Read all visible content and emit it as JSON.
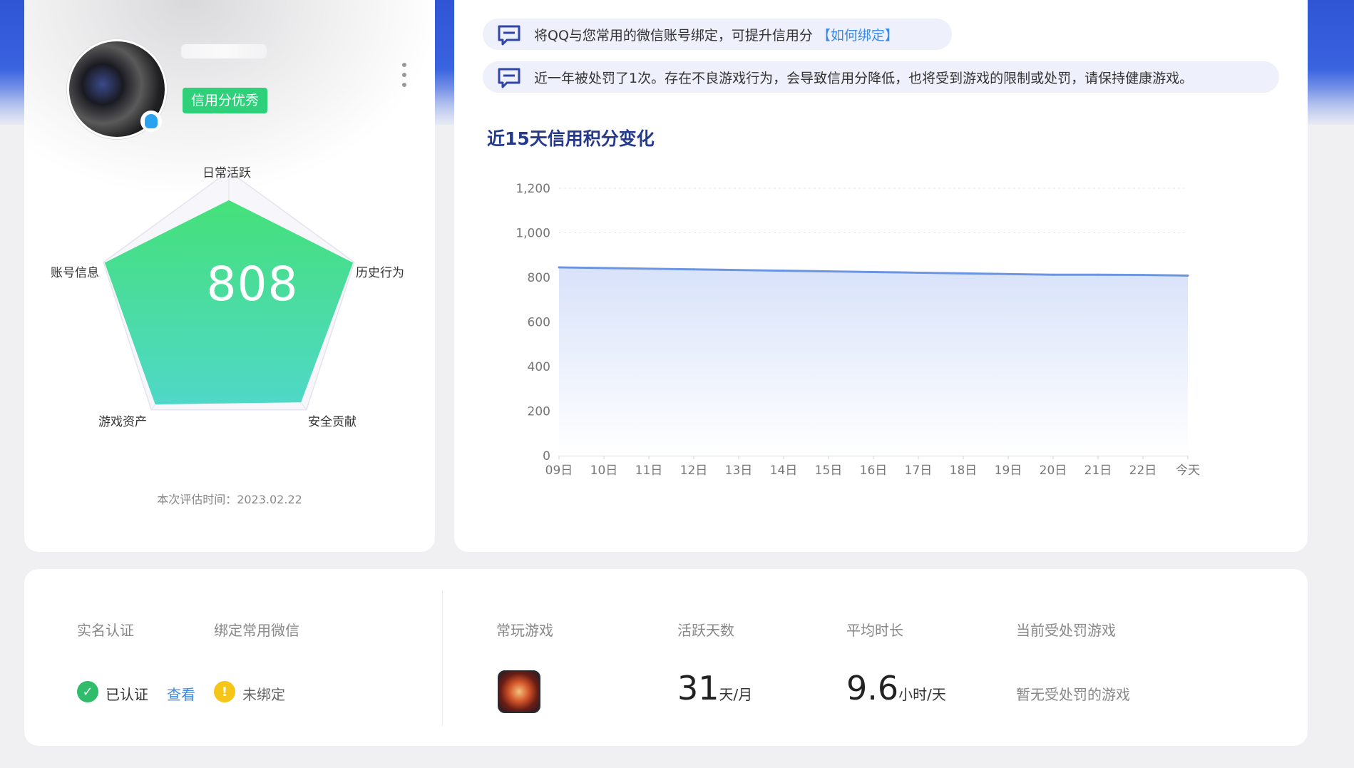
{
  "profile": {
    "credit_badge": "信用分优秀",
    "score": "808",
    "eval_time": "本次评估时间：2023.02.22",
    "radar": {
      "axes": [
        "日常活跃",
        "历史行为",
        "安全贡献",
        "游戏资产",
        "账号信息"
      ],
      "values": [
        0.78,
        0.99,
        0.93,
        0.95,
        0.99
      ]
    }
  },
  "notices": [
    {
      "text": "将QQ与您常用的微信账号绑定，可提升信用分",
      "link": "【如何绑定】"
    },
    {
      "text": "近一年被处罚了1次。存在不良游戏行为，会导致信用分降低，也将受到游戏的限制或处罚，请保持健康游戏。"
    }
  ],
  "chart_title": "近15天信用积分变化",
  "chart_data": {
    "type": "area",
    "title": "近15天信用积分变化",
    "x": [
      "09日",
      "10日",
      "11日",
      "12日",
      "13日",
      "14日",
      "15日",
      "16日",
      "17日",
      "18日",
      "19日",
      "20日",
      "21日",
      "22日",
      "今天"
    ],
    "series": [
      {
        "values": [
          845,
          842,
          839,
          836,
          833,
          830,
          827,
          824,
          821,
          818,
          815,
          812,
          812,
          811,
          808
        ]
      }
    ],
    "ylim": [
      0,
      1200
    ],
    "yticks": [
      "0",
      "200",
      "400",
      "600",
      "800",
      "1,000",
      "1,200"
    ],
    "grid": true,
    "colors": {
      "line": "#6b94e3",
      "fill_top": "#d8e2f9"
    }
  },
  "stats": {
    "realname": {
      "label": "实名认证",
      "status": "已认证",
      "link": "查看"
    },
    "wechat": {
      "label": "绑定常用微信",
      "status": "未绑定"
    },
    "games": {
      "label": "常玩游戏"
    },
    "active_days": {
      "label": "活跃天数",
      "value": "31",
      "unit": "天/月"
    },
    "avg_time": {
      "label": "平均时长",
      "value": "9.6",
      "unit": "小时/天"
    },
    "punished": {
      "label": "当前受处罚游戏",
      "value": "暂无受处罚的游戏"
    }
  }
}
